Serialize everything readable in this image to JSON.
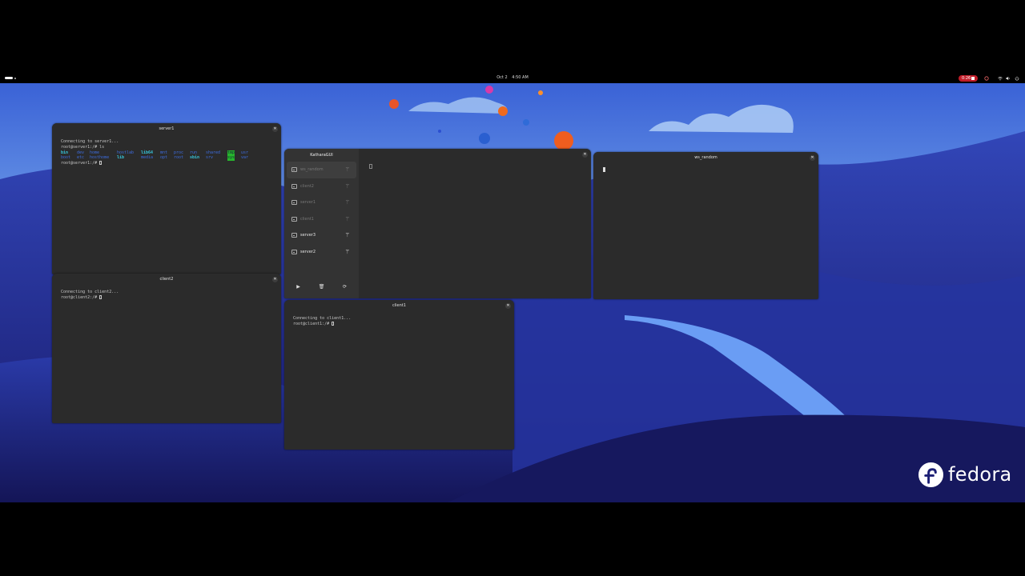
{
  "topbar": {
    "date": "Oct 2",
    "time": "4:50 AM",
    "recording_time": "0:26",
    "tray_icons": [
      "privacy-indicator-icon",
      "wifi-icon",
      "volume-icon",
      "power-icon"
    ]
  },
  "desktop": {
    "brand": "fedora",
    "colors": {
      "sky_top": "#3b66d9",
      "sky_bottom": "#8fb8ee",
      "hills_dark": "#1c1f74",
      "hills_mid": "#3a4bb8",
      "path": "#5b8ff0"
    }
  },
  "windows": {
    "server1": {
      "title": "server1",
      "lines": [
        "Connecting to server1...",
        "root@server1:/# ls"
      ],
      "ls_rows": [
        [
          "bin",
          "dev",
          "home",
          "hostlab",
          "lib64",
          "mnt",
          "proc",
          "run",
          "shared",
          "tmp",
          "usr"
        ],
        [
          "boot",
          "etc",
          "hosthome",
          "lib",
          "media",
          "opt",
          "root",
          "sbin",
          "srv",
          "sys",
          "var"
        ]
      ],
      "prompt": "root@server1:/# "
    },
    "client2": {
      "title": "client2",
      "lines": [
        "Connecting to client2..."
      ],
      "prompt": "root@client2:/# "
    },
    "client1": {
      "title": "client1",
      "lines": [
        "Connecting to client1..."
      ],
      "prompt": "root@client1:/# "
    },
    "ws_random": {
      "title": "ws_random"
    },
    "kathara": {
      "title": "KatharaGUI",
      "items": [
        {
          "label": "ws_random",
          "state": "dim"
        },
        {
          "label": "client2",
          "state": "dim"
        },
        {
          "label": "server1",
          "state": "dim"
        },
        {
          "label": "client1",
          "state": "dim"
        },
        {
          "label": "server3",
          "state": "active"
        },
        {
          "label": "server2",
          "state": "active"
        }
      ],
      "actions": [
        {
          "name": "start-button",
          "glyph": "▶"
        },
        {
          "name": "delete-button",
          "glyph": "🗑"
        },
        {
          "name": "refresh-button",
          "glyph": "⟳"
        }
      ]
    }
  }
}
